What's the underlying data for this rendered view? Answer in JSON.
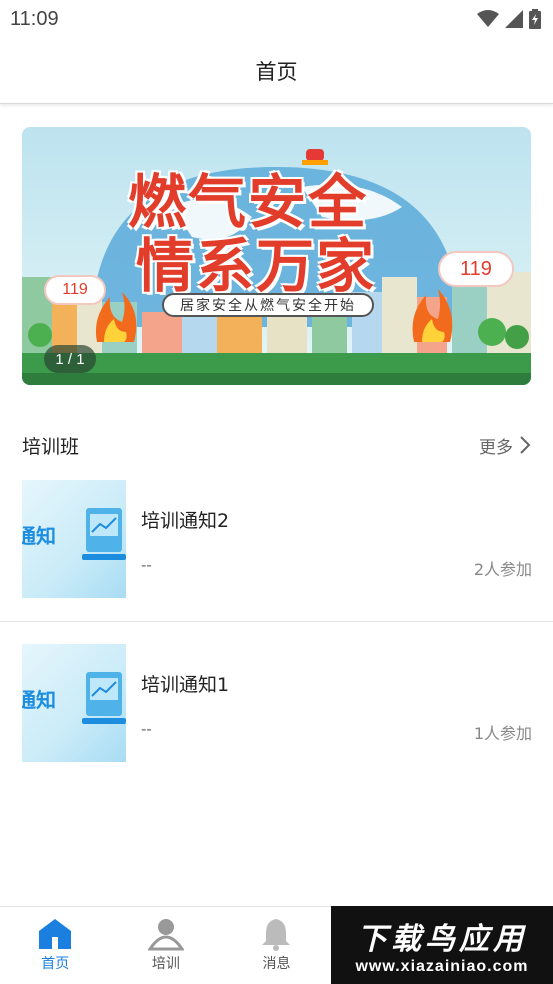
{
  "status_bar": {
    "time": "11:09"
  },
  "header": {
    "title": "首页"
  },
  "banner": {
    "headline_line1": "燃气安全",
    "headline_line2": "情系万家",
    "subtitle": "居家安全从燃气安全开始",
    "badge_left": "119",
    "badge_right": "119",
    "indicator": "1 / 1"
  },
  "section": {
    "title": "培训班",
    "more_label": "更多"
  },
  "courses": [
    {
      "thumb_text": "通知",
      "title": "培训通知2",
      "desc": "--",
      "count": "2人参加"
    },
    {
      "thumb_text": "通知",
      "title": "培训通知1",
      "desc": "--",
      "count": "1人参加"
    }
  ],
  "nav": {
    "items": [
      {
        "label": "首页",
        "icon": "home-icon",
        "active": true
      },
      {
        "label": "培训",
        "icon": "user-icon",
        "active": false
      },
      {
        "label": "消息",
        "icon": "bell-icon",
        "active": false
      }
    ]
  },
  "watermark": {
    "line1": "下载鸟应用",
    "line2": "www.xiazainiao.com"
  },
  "colors": {
    "accent": "#1b7fe0",
    "banner_red": "#e23c2a"
  }
}
